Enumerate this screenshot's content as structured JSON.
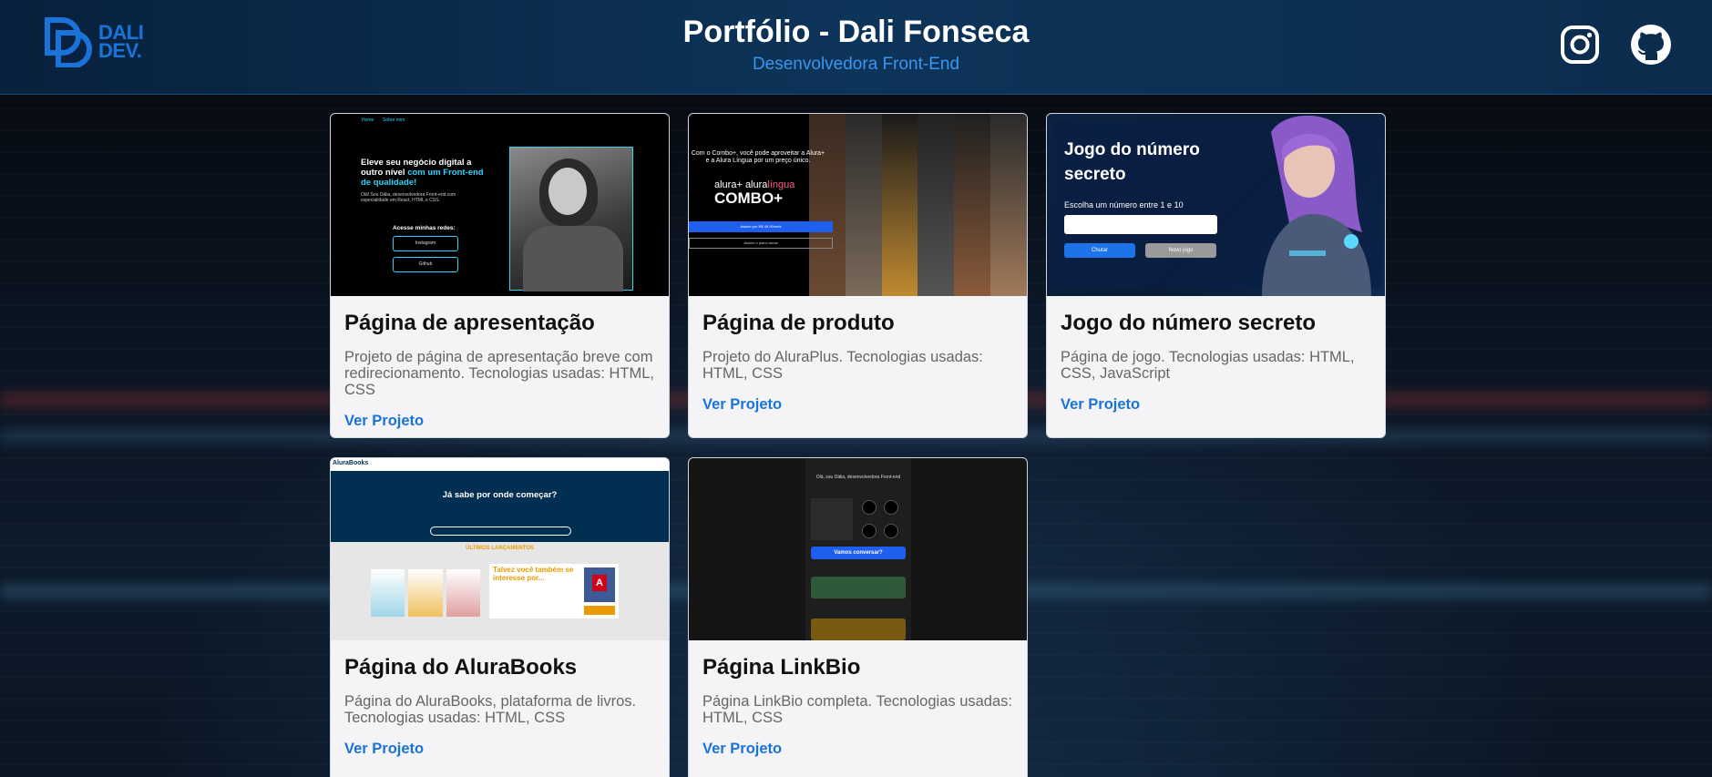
{
  "header": {
    "logo_text_line1": "DALI",
    "logo_text_line2": "DEV.",
    "title": "Portfólio - Dali Fonseca",
    "subtitle": "Desenvolvedora Front-End",
    "social": [
      {
        "name": "instagram-icon"
      },
      {
        "name": "github-icon"
      }
    ]
  },
  "colors": {
    "header_bg": "#0d3459",
    "accent": "#1a73d9",
    "subtitle": "#3a97f0",
    "card_bg": "#f4f4f6"
  },
  "projects": [
    {
      "title": "Página de apresentação",
      "description": "Projeto de página de apresentação breve com redirecionamento. Tecnologias usadas: HTML, CSS",
      "link": "Ver Projeto",
      "preview": {
        "headline_white": "Eleve seu negócio digital a outro nível",
        "headline_blue": "com um Front-end de qualidade!",
        "access": "Acesse minhas redes:",
        "buttons": [
          "Instagram",
          "Github"
        ]
      }
    },
    {
      "title": "Página de produto",
      "description": "Projeto do AluraPlus. Tecnologias usadas: HTML, CSS",
      "link": "Ver Projeto",
      "preview": {
        "text": "Com o Combo+, você pode aproveitar a Alura+ e a Alura Língua por um preço único.",
        "brand_line": "alura+ alura",
        "brand_accent": "língua",
        "brand_big": "COMBO+"
      }
    },
    {
      "title": "Jogo do número secreto",
      "description": "Página de jogo. Tecnologias usadas: HTML, CSS, JavaScript",
      "link": "Ver Projeto",
      "preview": {
        "game_title": "Jogo do número secreto",
        "prompt": "Escolha um número entre 1 e 10",
        "guess_button": "Chutar",
        "new_game_button": "Novo jogo"
      }
    },
    {
      "title": "Página do AluraBooks",
      "description": "Página do AluraBooks, plataforma de livros. Tecnologias usadas: HTML, CSS",
      "link": "Ver Projeto",
      "preview": {
        "logo": "AluraBooks",
        "hero": "Já sabe por onde começar?",
        "section": "ÚLTIMOS LANÇAMENTOS",
        "promo": "Talvez você também se interesse por..."
      }
    },
    {
      "title": "Página LinkBio",
      "description": "Página LinkBio completa. Tecnologias usadas: HTML, CSS",
      "link": "Ver Projeto",
      "preview": {
        "cta": "Vamos conversar?"
      }
    }
  ]
}
